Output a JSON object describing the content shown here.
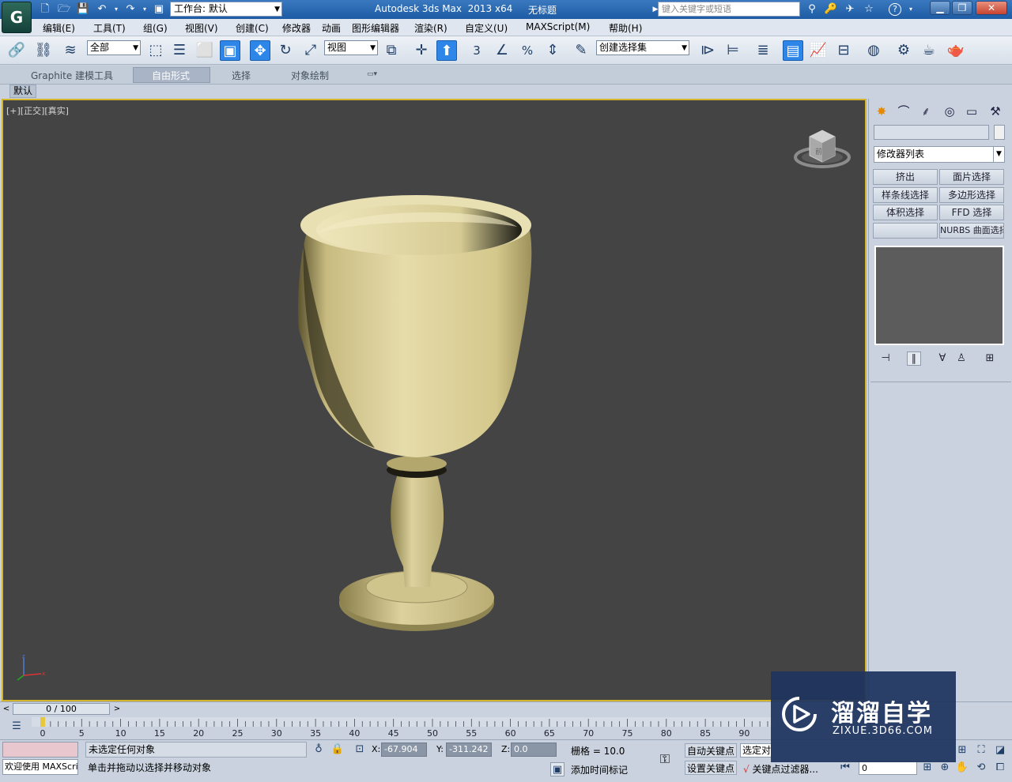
{
  "titlebar": {
    "app_logo": "G",
    "workspace": "工作台: 默认",
    "app_title": "Autodesk 3ds Max  2013 x64",
    "file_title": "无标题",
    "search_placeholder": "键入关键字或短语",
    "help": "?"
  },
  "menu": [
    "编辑(E)",
    "工具(T)",
    "组(G)",
    "视图(V)",
    "创建(C)",
    "修改器",
    "动画",
    "图形编辑器",
    "渲染(R)",
    "自定义(U)",
    "MAXScript(M)",
    "帮助(H)"
  ],
  "toolbar": {
    "selection_filter": "全部",
    "ref_coord": "视图",
    "named_selection": "创建选择集",
    "snap_label": "3",
    "percent_label": "%"
  },
  "ribbon": {
    "tabs": [
      "Graphite 建模工具",
      "自由形式",
      "选择",
      "对象绘制"
    ],
    "active_tab": "自由形式",
    "sub_tab": "默认"
  },
  "viewport": {
    "label": "[+][正交][真实]",
    "viewcube_face": "前",
    "object": "goblet",
    "object_color": "#d8cc8e",
    "background_color": "#444444",
    "active_border_color": "#d4b42a"
  },
  "command_panel": {
    "modifier_list": "修改器列表",
    "buttons": [
      "挤出",
      "面片选择",
      "样条线选择",
      "多边形选择",
      "体积选择",
      "FFD 选择",
      "",
      "NURBS 曲面选择"
    ]
  },
  "timeslider": {
    "position": "0 / 100",
    "prev": "<",
    "next": ">"
  },
  "track": {
    "labels": [
      "0",
      "5",
      "10",
      "15",
      "20",
      "25",
      "30",
      "35",
      "40",
      "45",
      "50",
      "55",
      "60",
      "65",
      "70",
      "75",
      "80",
      "85",
      "90"
    ]
  },
  "status": {
    "welcome": "欢迎使用 MAXScri",
    "selection": "未选定任何对象",
    "prompt": "单击并拖动以选择并移动对象",
    "x_label": "X:",
    "x": "-67.904",
    "y_label": "Y:",
    "y": "-311.242",
    "z_label": "Z:",
    "z": "0.0",
    "grid": "栅格 = 10.0",
    "add_time_tag": "添加时间标记",
    "auto_key": "自动关键点",
    "set_key": "设置关键点",
    "selected": "选定对象",
    "key_filters": "关键点过滤器...",
    "frame": "0"
  },
  "watermark": {
    "title": "溜溜自学",
    "url": "ZIXUE.3D66.COM"
  }
}
